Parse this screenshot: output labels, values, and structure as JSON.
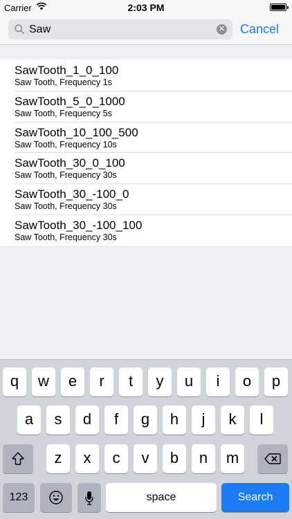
{
  "status_bar": {
    "carrier": "Carrier",
    "time": "2:03 PM",
    "battery_level": 1.0
  },
  "search": {
    "query": "Saw",
    "cancel_label": "Cancel"
  },
  "results": [
    {
      "title": "SawTooth_1_0_100",
      "subtitle": "Saw Tooth, Frequency 1s"
    },
    {
      "title": "SawTooth_5_0_1000",
      "subtitle": "Saw Tooth, Frequency 5s"
    },
    {
      "title": "SawTooth_10_100_500",
      "subtitle": "Saw Tooth, Frequency 10s"
    },
    {
      "title": "SawTooth_30_0_100",
      "subtitle": "Saw Tooth, Frequency 30s"
    },
    {
      "title": "SawTooth_30_-100_0",
      "subtitle": "Saw Tooth, Frequency 30s"
    },
    {
      "title": "SawTooth_30_-100_100",
      "subtitle": "Saw Tooth, Frequency 30s"
    }
  ],
  "keyboard": {
    "row1": [
      "q",
      "w",
      "e",
      "r",
      "t",
      "y",
      "u",
      "i",
      "o",
      "p"
    ],
    "row2": [
      "a",
      "s",
      "d",
      "f",
      "g",
      "h",
      "j",
      "k",
      "l"
    ],
    "row3": [
      "z",
      "x",
      "c",
      "v",
      "b",
      "n",
      "m"
    ],
    "numbers_label": "123",
    "space_label": "space",
    "search_label": "Search"
  },
  "colors": {
    "accent": "#1a7bf5",
    "background": "#efeff4",
    "keyboard": "#d1d4d9"
  }
}
